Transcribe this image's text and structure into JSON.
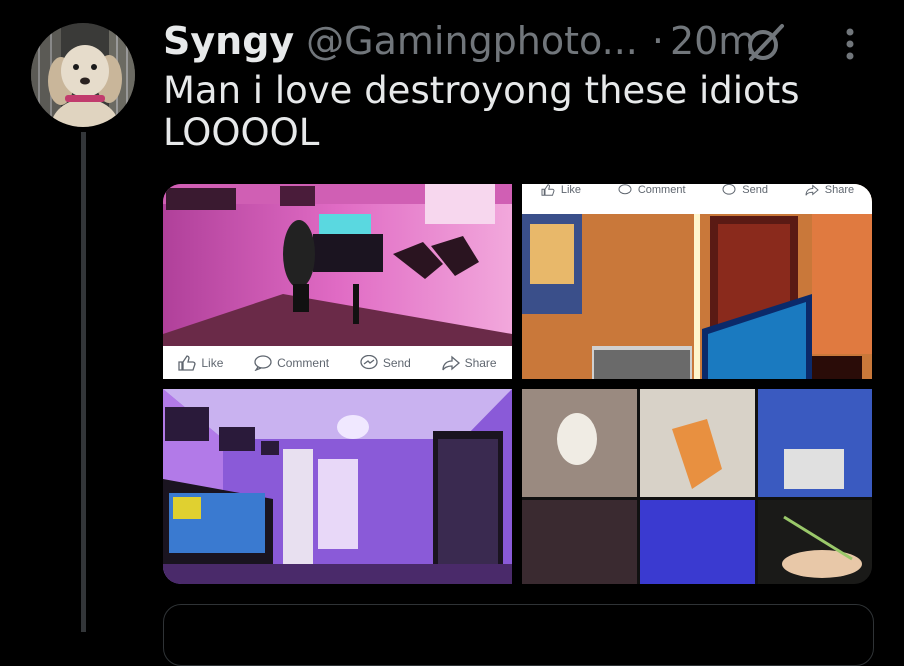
{
  "tweet": {
    "display_name": "Syngy",
    "handle": "@Gamingphoto...",
    "separator": "·",
    "time": "20m",
    "text": "Man i love destroyong these idiots LOOOOL"
  },
  "icons": {
    "grok": "grok-icon",
    "more": "more-icon"
  },
  "media": {
    "fb_actions": {
      "like": "Like",
      "comment": "Comment",
      "send": "Send",
      "share": "Share"
    }
  }
}
